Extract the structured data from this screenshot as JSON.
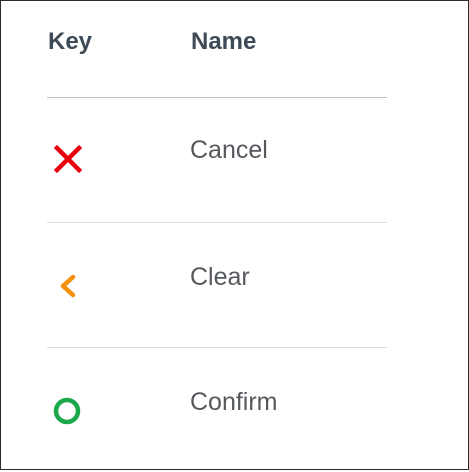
{
  "table": {
    "headers": {
      "key": "Key",
      "name": "Name"
    },
    "rows": [
      {
        "icon": "close-x-icon",
        "icon_color": "#e8000d",
        "name": "Cancel"
      },
      {
        "icon": "chevron-left-icon",
        "icon_color": "#f5900a",
        "name": "Clear"
      },
      {
        "icon": "circle-icon",
        "icon_color": "#1aa84b",
        "name": "Confirm"
      }
    ]
  }
}
